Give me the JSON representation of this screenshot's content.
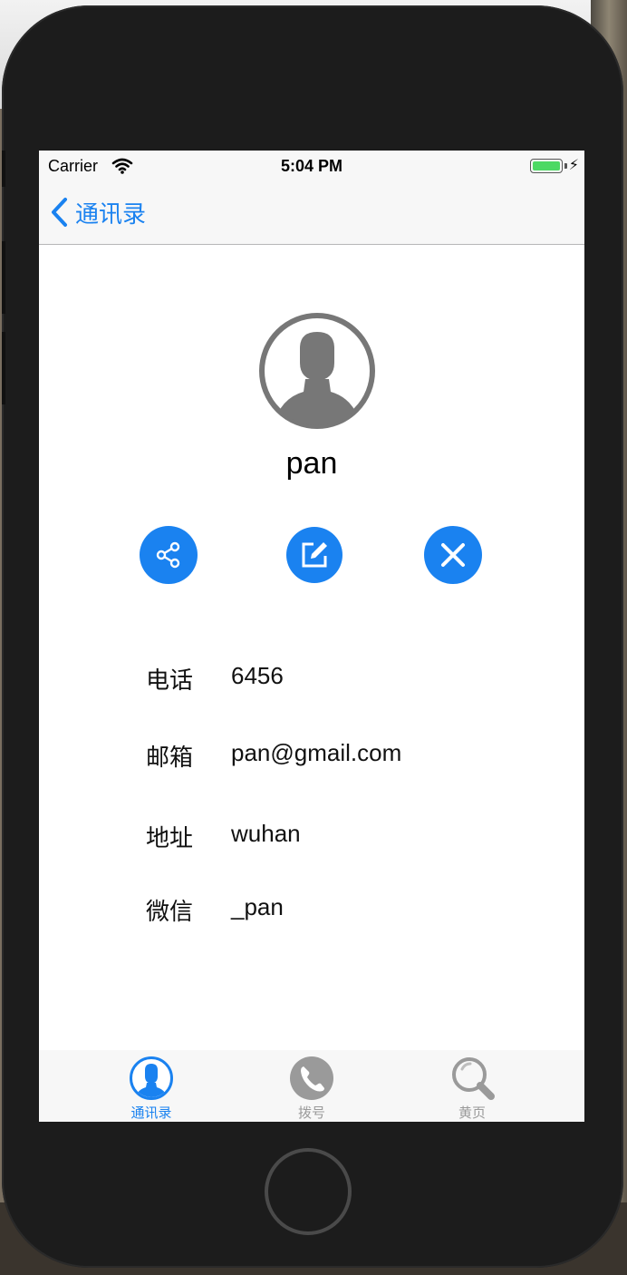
{
  "status_bar": {
    "carrier": "Carrier",
    "time": "5:04 PM",
    "wifi_icon": "wifi-icon",
    "battery_icon": "battery-icon",
    "charging_icon": "charging-bolt-icon"
  },
  "nav": {
    "back_label": "通讯录",
    "back_icon": "chevron-left-icon"
  },
  "contact": {
    "name": "pan",
    "avatar_icon": "person-silhouette-icon"
  },
  "actions": [
    {
      "name": "share",
      "icon": "share-icon"
    },
    {
      "name": "edit",
      "icon": "edit-icon"
    },
    {
      "name": "delete",
      "icon": "close-icon"
    }
  ],
  "info": [
    {
      "label": "电话",
      "value": "6456"
    },
    {
      "label": "邮箱",
      "value": "pan@gmail.com"
    },
    {
      "label": "地址",
      "value": "wuhan"
    },
    {
      "label": "微信",
      "value": "_pan"
    }
  ],
  "tabs": [
    {
      "label": "通讯录",
      "icon": "contacts-icon",
      "selected": true
    },
    {
      "label": "拨号",
      "icon": "phone-icon",
      "selected": false
    },
    {
      "label": "黄页",
      "icon": "search-icon",
      "selected": false
    }
  ],
  "colors": {
    "accent": "#1a82f0",
    "inactive": "#9a9a9a",
    "bar_bg": "#f7f7f7",
    "battery": "#4cd964"
  }
}
